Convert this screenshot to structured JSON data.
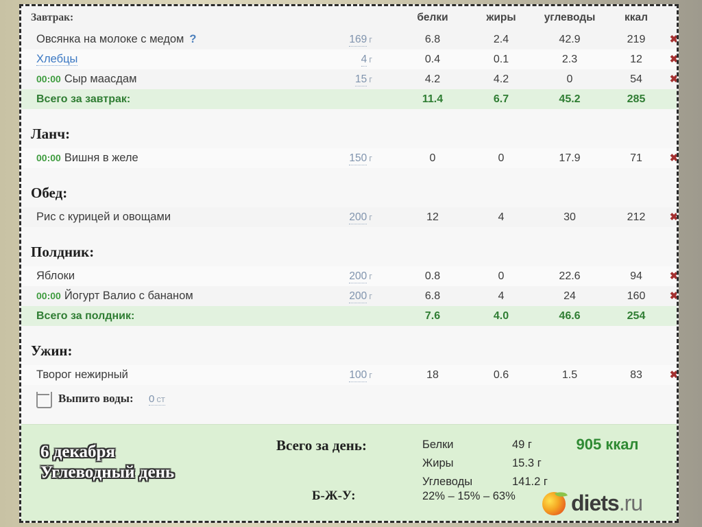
{
  "columns": {
    "protein": "белки",
    "fat": "жиры",
    "carbs": "углеводы",
    "kcal": "ккал"
  },
  "units": {
    "gram": "г",
    "cup": "ст"
  },
  "delete_icon": "✖",
  "meals": [
    {
      "title": "Завтрак:",
      "items": [
        {
          "time": "",
          "name": "Овсянка на молоке с медом",
          "question": "?",
          "link": false,
          "weight": "169",
          "p": "6.8",
          "f": "2.4",
          "c": "42.9",
          "k": "219"
        },
        {
          "time": "",
          "name": "Хлебцы",
          "question": "",
          "link": true,
          "weight": "4",
          "p": "0.4",
          "f": "0.1",
          "c": "2.3",
          "k": "12"
        },
        {
          "time": "00:00",
          "name": "Сыр маасдам",
          "question": "",
          "link": false,
          "weight": "15",
          "p": "4.2",
          "f": "4.2",
          "c": "0",
          "k": "54"
        }
      ],
      "total": {
        "label": "Всего за завтрак:",
        "p": "11.4",
        "f": "6.7",
        "c": "45.2",
        "k": "285"
      }
    },
    {
      "title": "Ланч:",
      "items": [
        {
          "time": "00:00",
          "name": "Вишня в желе",
          "question": "",
          "link": false,
          "weight": "150",
          "p": "0",
          "f": "0",
          "c": "17.9",
          "k": "71"
        }
      ],
      "total": null
    },
    {
      "title": "Обед:",
      "items": [
        {
          "time": "",
          "name": "Рис с курицей и овощами",
          "question": "",
          "link": false,
          "weight": "200",
          "p": "12",
          "f": "4",
          "c": "30",
          "k": "212"
        }
      ],
      "total": null
    },
    {
      "title": "Полдник:",
      "items": [
        {
          "time": "",
          "name": "Яблоки",
          "question": "",
          "link": false,
          "weight": "200",
          "p": "0.8",
          "f": "0",
          "c": "22.6",
          "k": "94"
        },
        {
          "time": "00:00",
          "name": "Йогурт Валио с бананом",
          "question": "",
          "link": false,
          "weight": "200",
          "p": "6.8",
          "f": "4",
          "c": "24",
          "k": "160"
        }
      ],
      "total": {
        "label": "Всего за полдник:",
        "p": "7.6",
        "f": "4.0",
        "c": "46.6",
        "k": "254"
      }
    },
    {
      "title": "Ужин:",
      "items": [
        {
          "time": "",
          "name": "Творог нежирный",
          "question": "",
          "link": false,
          "weight": "100",
          "p": "18",
          "f": "0.6",
          "c": "1.5",
          "k": "83"
        }
      ],
      "total": null
    }
  ],
  "water": {
    "label": "Выпито воды:",
    "value": "0",
    "unit": "ст"
  },
  "footer": {
    "date": "6 декабря",
    "day_type": "Углеводный день",
    "total_label": "Всего за день:",
    "macros": [
      {
        "name": "Белки",
        "value": "49 г"
      },
      {
        "name": "Жиры",
        "value": "15.3 г"
      },
      {
        "name": "Углеводы",
        "value": "141.2 г"
      }
    ],
    "kcal_total": "905 ккал",
    "bju_label": "Б-Ж-У:",
    "bju_value": "22% – 15% – 63%",
    "logo_main": "diets",
    "logo_tld": ".ru"
  },
  "colors": {
    "accent_green": "#2f7d33",
    "link_blue": "#3b78c3",
    "delete_red": "#a33030",
    "footer_bg": "#dcf0d4",
    "total_row_bg": "#e2f2df"
  }
}
